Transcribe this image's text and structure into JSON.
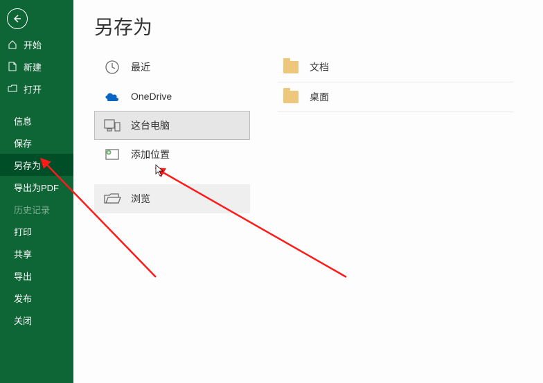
{
  "sidebar": {
    "back": "←",
    "primary": [
      {
        "label": "开始",
        "icon": "home"
      },
      {
        "label": "新建",
        "icon": "new"
      },
      {
        "label": "打开",
        "icon": "open"
      }
    ],
    "items": [
      {
        "label": "信息",
        "selected": false,
        "disabled": false
      },
      {
        "label": "保存",
        "selected": false,
        "disabled": false
      },
      {
        "label": "另存为",
        "selected": true,
        "disabled": false
      },
      {
        "label": "导出为PDF",
        "selected": false,
        "disabled": false
      },
      {
        "label": "历史记录",
        "selected": false,
        "disabled": true
      },
      {
        "label": "打印",
        "selected": false,
        "disabled": false
      },
      {
        "label": "共享",
        "selected": false,
        "disabled": false
      },
      {
        "label": "导出",
        "selected": false,
        "disabled": false
      },
      {
        "label": "发布",
        "selected": false,
        "disabled": false
      },
      {
        "label": "关闭",
        "selected": false,
        "disabled": false
      }
    ]
  },
  "title": "另存为",
  "locations": [
    {
      "label": "最近",
      "icon": "recent",
      "selected": false
    },
    {
      "label": "OneDrive",
      "icon": "onedrive",
      "selected": false
    },
    {
      "label": "这台电脑",
      "icon": "thispc",
      "selected": true
    },
    {
      "label": "添加位置",
      "icon": "addloc",
      "selected": false
    }
  ],
  "browse": {
    "label": "浏览",
    "icon": "browse"
  },
  "folders": [
    {
      "label": "文档"
    },
    {
      "label": "桌面"
    }
  ]
}
